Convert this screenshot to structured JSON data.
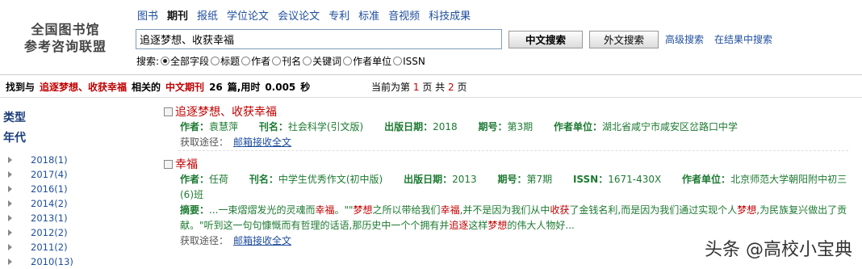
{
  "logo": {
    "line1": "全国图书馆",
    "line2": "参考咨询联盟"
  },
  "nav": [
    "图书",
    "期刊",
    "报纸",
    "学位论文",
    "会议论文",
    "专利",
    "标准",
    "音视频",
    "科技成果"
  ],
  "search": {
    "value": "追逐梦想、收获幸福",
    "btn_cn": "中文搜索",
    "btn_foreign": "外文搜索",
    "advanced": "高级搜索",
    "within": "在结果中搜索"
  },
  "fields": {
    "label": "搜索:",
    "options": [
      "全部字段",
      "标题",
      "作者",
      "刊名",
      "关键词",
      "作者单位",
      "ISSN"
    ],
    "selected": "全部字段"
  },
  "summary": {
    "prefix": "找到与",
    "query": "追逐梦想、收获幸福",
    "mid": "相关的",
    "type": "中文期刊",
    "count": "26",
    "count_suffix": "篇,用时",
    "time": "0.005",
    "time_suffix": "秒"
  },
  "pageinfo": {
    "prefix": "当前为第",
    "current": "1",
    "mid": "页 共",
    "total": "2",
    "suffix": "页"
  },
  "sidebar": {
    "heading_type": "类型",
    "heading_year": "年代",
    "years": [
      "2018(1)",
      "2017(4)",
      "2016(1)",
      "2014(2)",
      "2013(1)",
      "2012(2)",
      "2011(2)",
      "2010(13)"
    ]
  },
  "results": [
    {
      "title": "追逐梦想、收获幸福",
      "author_label": "作者：",
      "author": "袁慧萍",
      "journal_label": "刊名：",
      "journal": "社会科学(引文版)",
      "date_label": "出版日期：",
      "date": "2018",
      "issue_label": "期号：",
      "issue": "第3期",
      "org_label": "作者单位：",
      "org": "湖北省咸宁市咸安区岔路口中学",
      "access_label": "获取途径：",
      "access_link": "邮箱接收全文"
    },
    {
      "title": "幸福",
      "author_label": "作者：",
      "author": "任荷",
      "journal_label": "刊名：",
      "journal": "中学生优秀作文(初中版)",
      "date_label": "出版日期：",
      "date": "2013",
      "issue_label": "期号：",
      "issue": "第7期",
      "issn_label": "ISSN：",
      "issn": "1671-430X",
      "org_label": "作者单位：",
      "org": "北京师范大学朝阳附中初三(6)班",
      "abstract_label": "摘要：",
      "abstract_parts": [
        "...一束熠熠发光的灵魂而",
        "幸福",
        "。\"\"",
        "梦想",
        "之所以带给我们",
        "幸福",
        ",并不是因为我们从中",
        "收获",
        "了金钱名利,而是因为我们通过实现个人",
        "梦想",
        ",为民族复兴做出了贡献。\"听到这一句句慷慨而有哲理的话语,那历史中一个个拥有并",
        "追逐",
        "这样",
        "梦想",
        "的伟大人物好..."
      ],
      "access_label": "获取途径：",
      "access_link": "邮箱接收全文"
    }
  ],
  "watermark": "头条 @高校小宝典"
}
